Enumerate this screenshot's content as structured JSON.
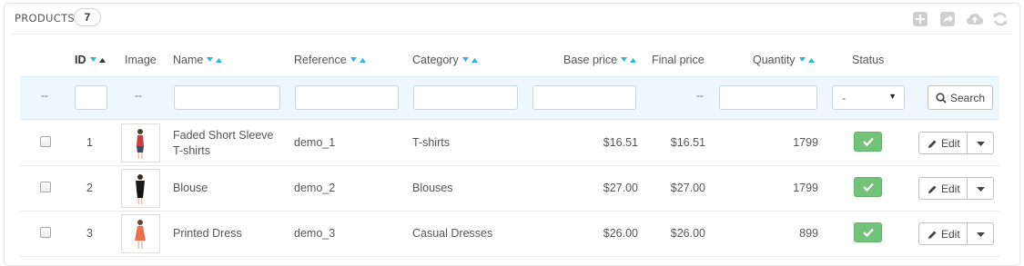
{
  "panel": {
    "title": "PRODUCTS",
    "count": "7",
    "toolbar": [
      {
        "name": "add-new-icon"
      },
      {
        "name": "export-icon"
      },
      {
        "name": "import-icon"
      },
      {
        "name": "refresh-icon"
      }
    ]
  },
  "columns": {
    "id": "ID",
    "image": "Image",
    "name": "Name",
    "reference": "Reference",
    "category": "Category",
    "base_price": "Base price",
    "final_price": "Final price",
    "quantity": "Quantity",
    "status": "Status"
  },
  "filters": {
    "dash": "--",
    "status_selected": "-",
    "search_label": "Search"
  },
  "rows": [
    {
      "id": "1",
      "name": "Faded Short Sleeve T-shirts",
      "reference": "demo_1",
      "category": "T-shirts",
      "base_price": "$16.51",
      "final_price": "$16.51",
      "quantity": "1799",
      "status": "enabled",
      "action": "Edit"
    },
    {
      "id": "2",
      "name": "Blouse",
      "reference": "demo_2",
      "category": "Blouses",
      "base_price": "$27.00",
      "final_price": "$27.00",
      "quantity": "1799",
      "status": "enabled",
      "action": "Edit"
    },
    {
      "id": "3",
      "name": "Printed Dress",
      "reference": "demo_3",
      "category": "Casual Dresses",
      "base_price": "$26.00",
      "final_price": "$26.00",
      "quantity": "899",
      "status": "enabled",
      "action": "Edit"
    }
  ],
  "colors": {
    "sort_arrow": "#25b9d7",
    "status_enabled": "#72c279",
    "filter_row_bg": "#edf7fc"
  }
}
